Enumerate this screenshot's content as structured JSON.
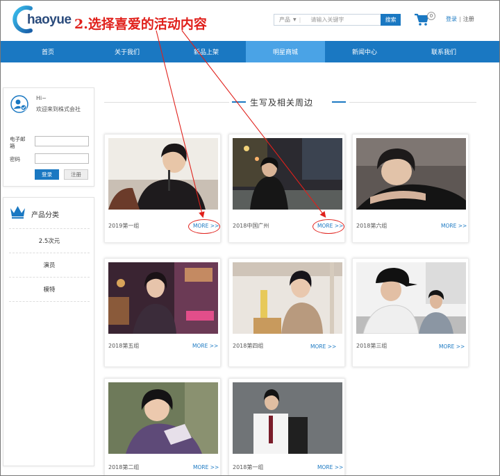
{
  "logo": {
    "text": "haoyue"
  },
  "annotation": {
    "text": "2.选择喜爱的活动内容"
  },
  "search": {
    "category": "产品",
    "placeholder": "请输入关键字",
    "button": "搜索"
  },
  "cart": {
    "count": "0"
  },
  "top_links": {
    "login": "登录",
    "separator": "|",
    "register": "注册"
  },
  "nav": [
    "首页",
    "关于我们",
    "新品上架",
    "明星商城",
    "新闻中心",
    "联系我们"
  ],
  "login_box": {
    "hi": "Hi~",
    "welcome": "欢迎来到株式会社",
    "email_label": "电子邮箱",
    "password_label": "密码",
    "login_button": "登录",
    "register_button": "注册"
  },
  "categories": {
    "title": "产品分类",
    "items": [
      "2.5次元",
      "演员",
      "模特"
    ]
  },
  "section_title": "生写及相关周边",
  "cards": [
    {
      "label": "2019第一组",
      "more": "MORE >>"
    },
    {
      "label": "2018中国广州",
      "more": "MORE >>"
    },
    {
      "label": "2018第六组",
      "more": "MORE >>"
    },
    {
      "label": "2018第五组",
      "more": "MORE >>"
    },
    {
      "label": "2018第四组",
      "more": "MORE >>"
    },
    {
      "label": "2018第三组",
      "more": "MORE >>"
    },
    {
      "label": "2018第二组",
      "more": "MORE >>"
    },
    {
      "label": "2018第一组",
      "more": "MORE >>"
    }
  ],
  "colors": {
    "brand_blue": "#1a78c2",
    "nav_active": "#4aa3e6",
    "annotation_red": "#e0201b"
  }
}
